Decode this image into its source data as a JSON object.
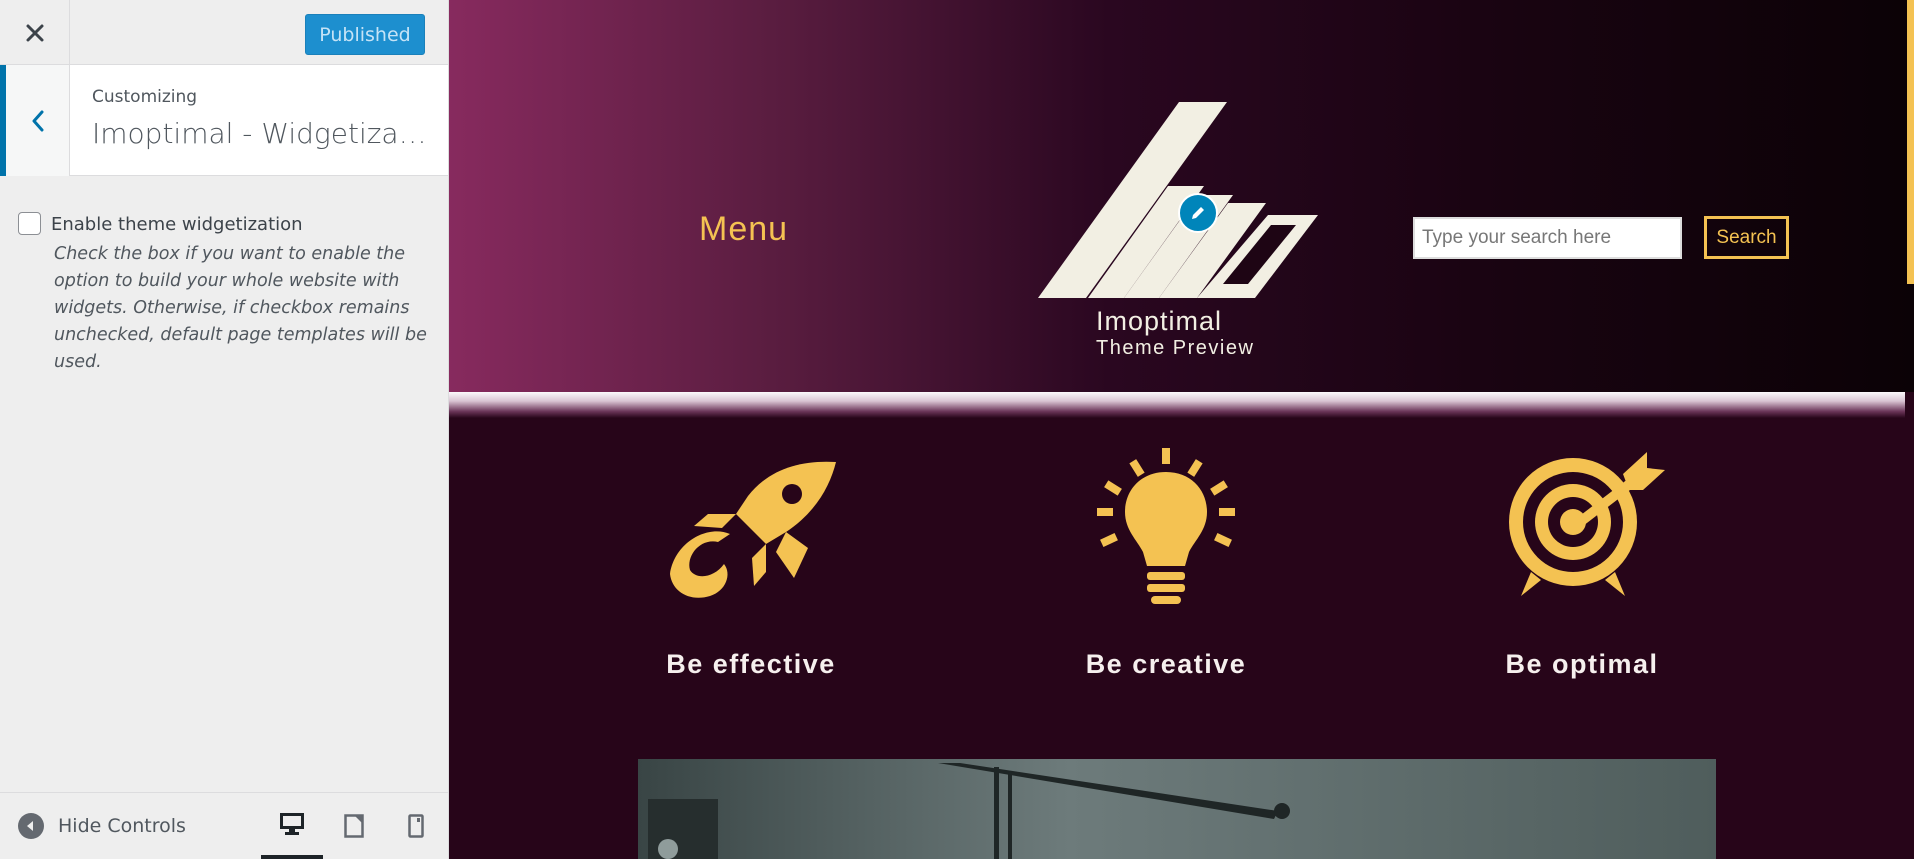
{
  "sidebar": {
    "close_label": "Close",
    "publish_label": "Published",
    "back_label": "Back",
    "customizing_label": "Customizing",
    "section_title": "Imoptimal - Widgetization",
    "checkbox": {
      "label": "Enable theme widgetization",
      "checked": false,
      "description": "Check the box if you want to enable the option to build your whole website with widgets. Otherwise, if checkbox remains unchecked, default page templates will be used."
    },
    "footer": {
      "hide_controls_label": "Hide Controls",
      "devices": [
        "desktop",
        "tablet",
        "mobile"
      ],
      "active_device": "desktop"
    }
  },
  "preview": {
    "menu_label": "Menu",
    "site_title": "Imoptimal",
    "site_tagline": "Theme Preview",
    "search": {
      "placeholder": "Type your search here",
      "button_label": "Search"
    },
    "features": [
      {
        "title": "Be effective",
        "icon": "rocket-icon"
      },
      {
        "title": "Be creative",
        "icon": "lightbulb-icon"
      },
      {
        "title": "Be optimal",
        "icon": "target-icon"
      }
    ]
  },
  "colors": {
    "accent": "#f4c252",
    "publish_button": "#1d8fcf",
    "wp_blue": "#0073aa",
    "header_gradient_start": "#872a5e",
    "preview_background": "#270519"
  }
}
